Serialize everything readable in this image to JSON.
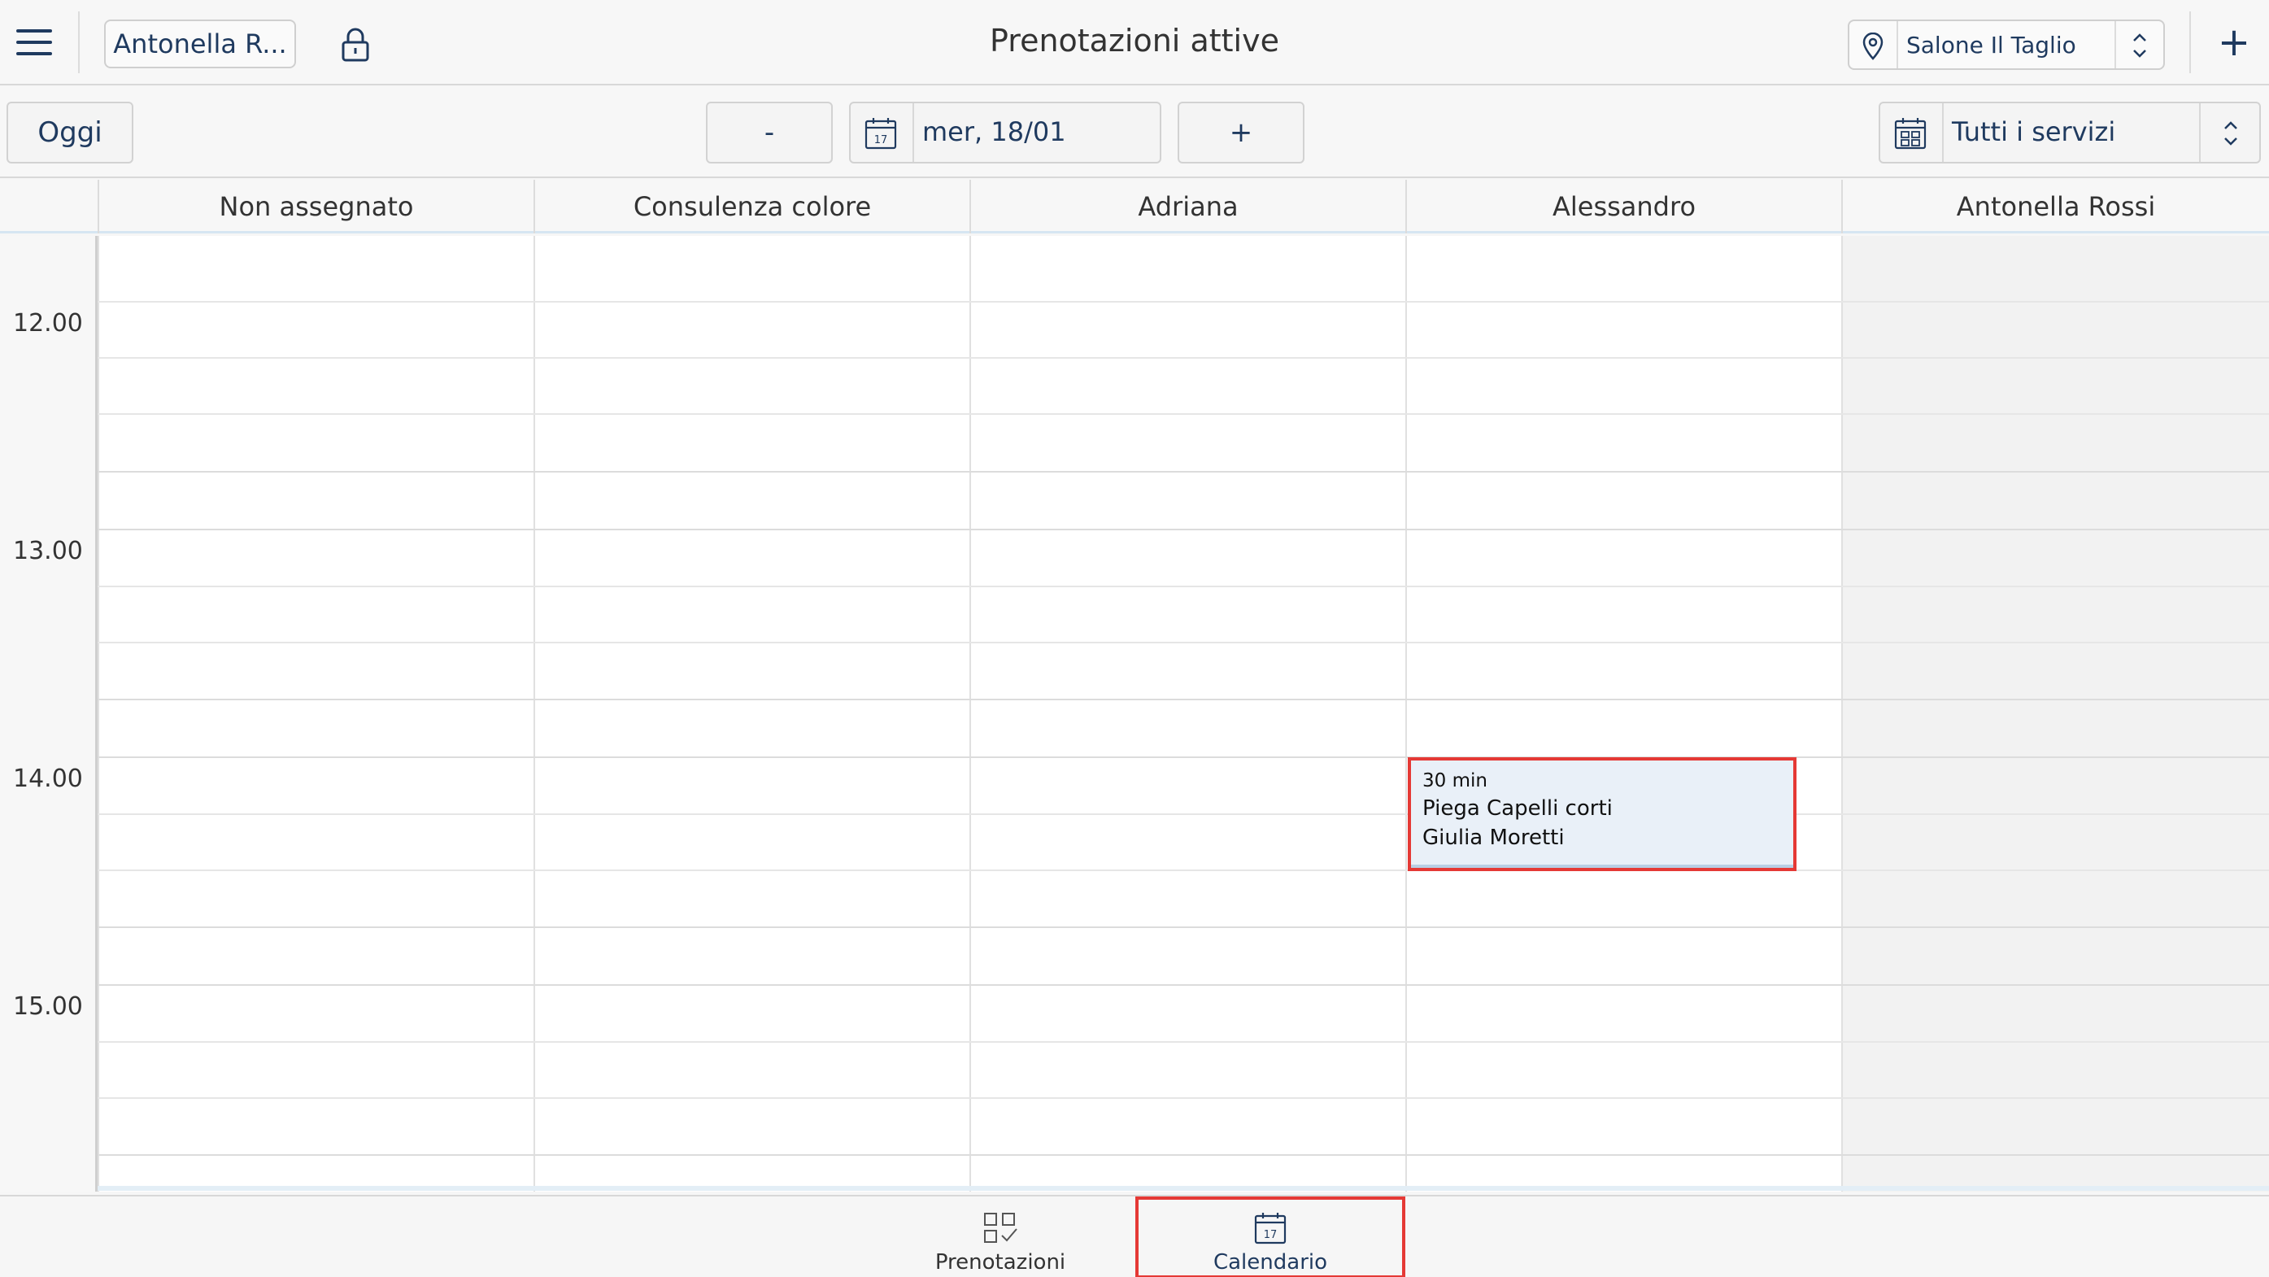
{
  "topbar": {
    "user_button": "Antonella R...",
    "title": "Prenotazioni attive",
    "location": "Salone Il Taglio",
    "add_label": "+"
  },
  "toolbar": {
    "today_label": "Oggi",
    "prev_label": "-",
    "date_label": "mer, 18/01",
    "date_icon_day": "17",
    "next_label": "+",
    "services_label": "Tutti i servizi"
  },
  "calendar": {
    "columns": [
      "Non assegnato",
      "Consulenza colore",
      "Adriana",
      "Alessandro",
      "Antonella Rossi"
    ],
    "times": [
      "12.00",
      "13.00",
      "14.00",
      "15.00"
    ],
    "appointment": {
      "duration": "30 min",
      "service": "Piega Capelli corti",
      "client": "Giulia Moretti",
      "column": "Alessandro",
      "start": "14.00"
    }
  },
  "bottom_nav": {
    "items": [
      {
        "label": "Prenotazioni",
        "icon": "bookings-icon"
      },
      {
        "label": "Calendario",
        "icon": "calendar-icon",
        "day": "17",
        "active": true
      }
    ]
  },
  "colors": {
    "accent": "#1f3a5f",
    "highlight": "#e53935",
    "appointment_bg": "#e9f0f8"
  }
}
